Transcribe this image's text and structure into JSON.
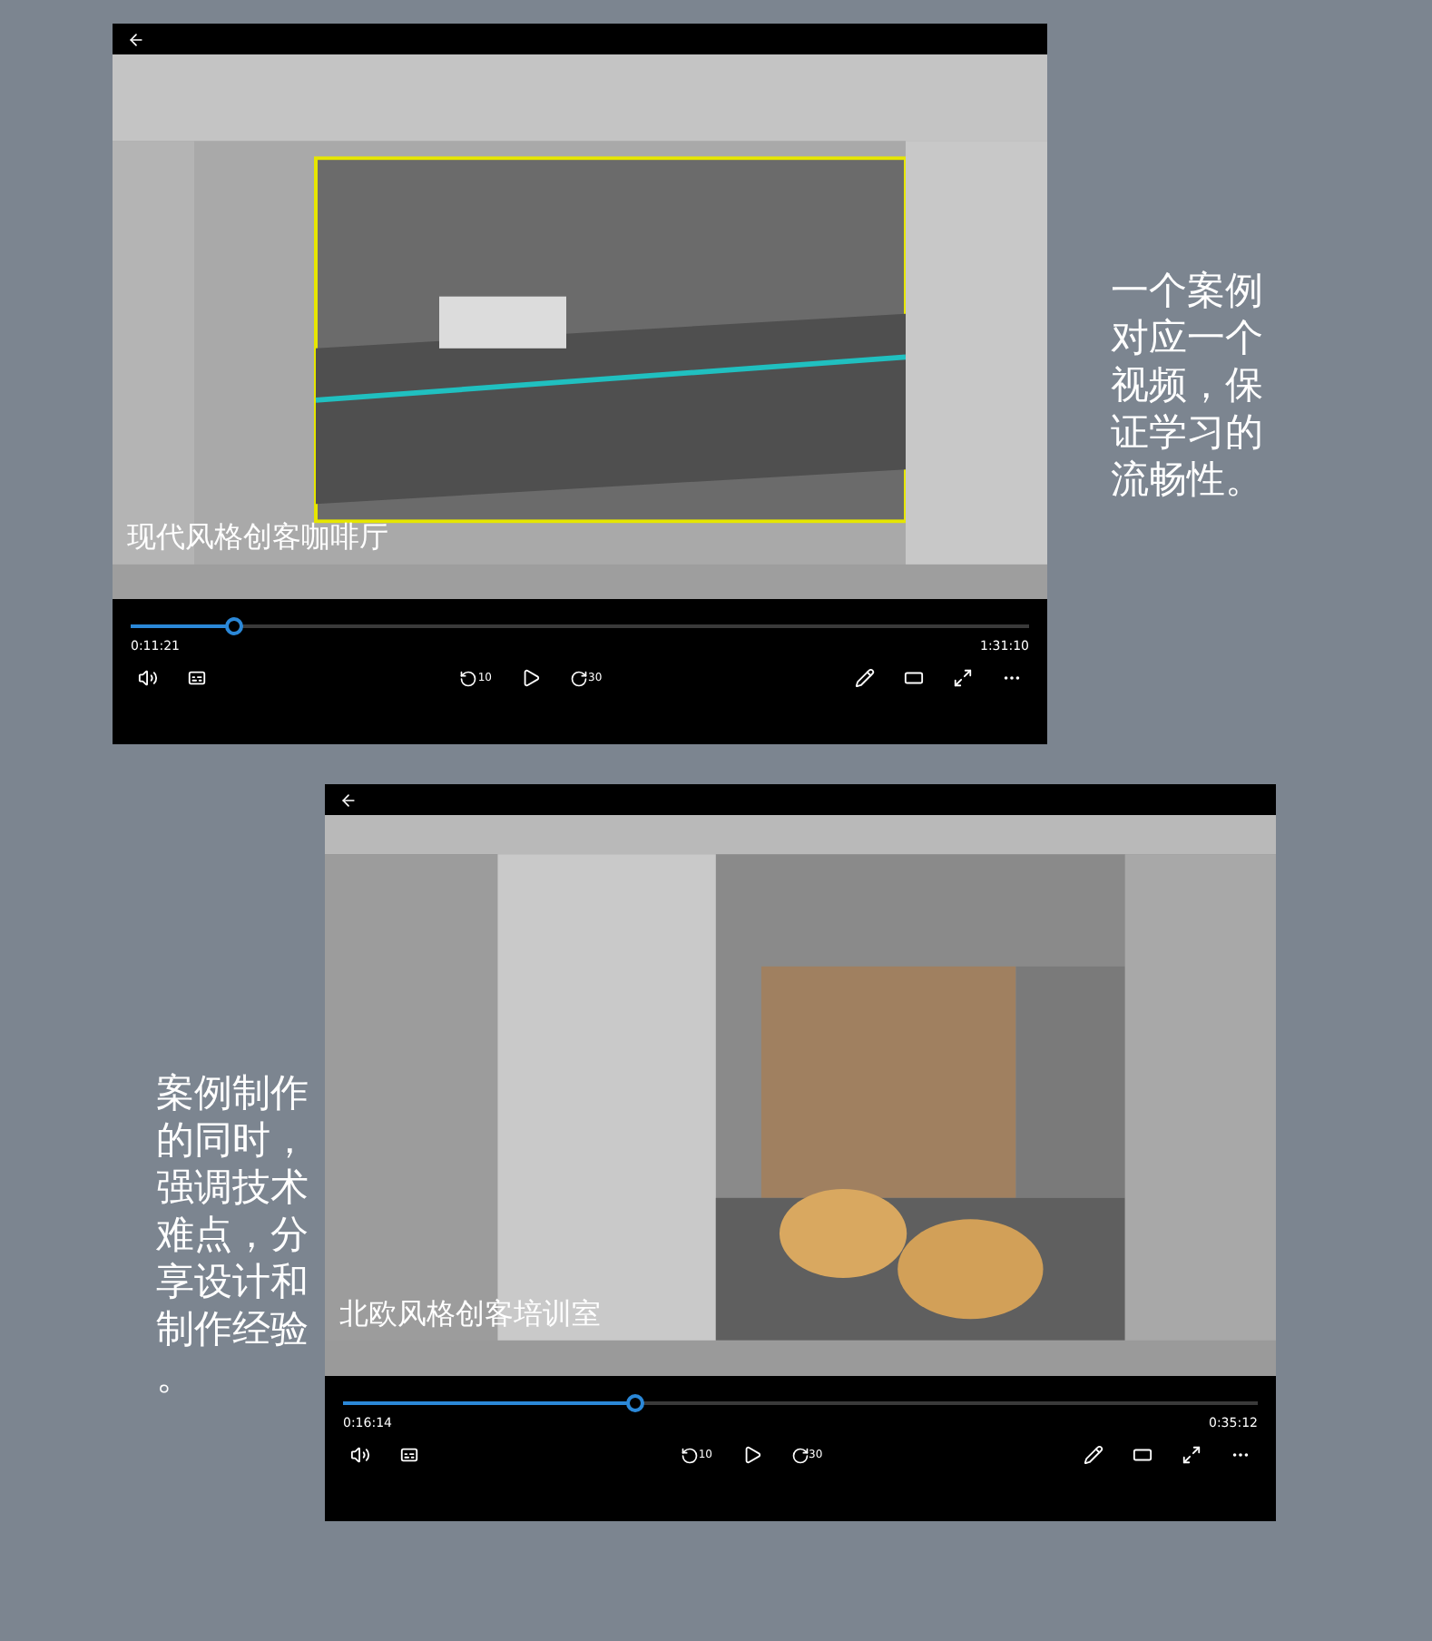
{
  "players": [
    {
      "caption": "现代风格创客咖啡厅",
      "progress": {
        "level": 0.115
      },
      "elapsed": "0:11:21",
      "duration": "1:31:10",
      "skip_back": "10",
      "skip_forward": "30",
      "note": "一个案例对应一个视频，保证学习的流畅性。"
    },
    {
      "caption": "北欧风格创客培训室",
      "progress": {
        "level": 0.32
      },
      "elapsed": "0:16:14",
      "duration": "0:35:12",
      "skip_back": "10",
      "skip_forward": "30",
      "note": "案例制作的同时，强调技术难点，分享设计和制作经验。"
    }
  ]
}
